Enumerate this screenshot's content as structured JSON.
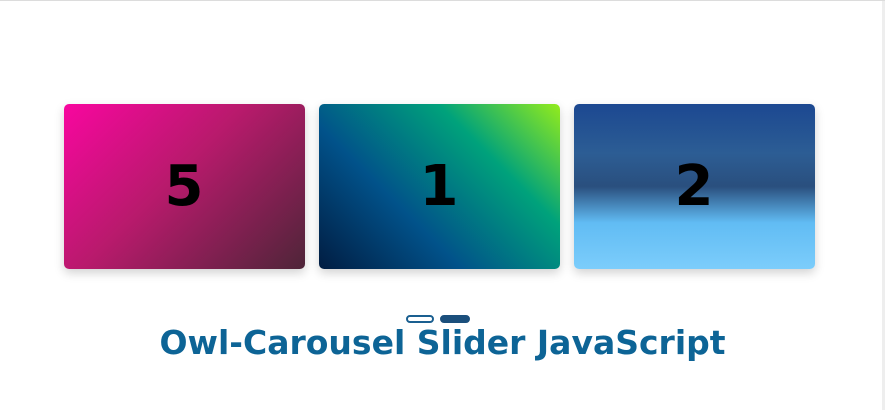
{
  "carousel": {
    "slides": [
      {
        "number": "5"
      },
      {
        "number": "1"
      },
      {
        "number": "2"
      }
    ],
    "dots": {
      "count": 2,
      "active_index": 1
    }
  },
  "page": {
    "title": "Owl-Carousel Slider JavaScript"
  },
  "colors": {
    "title": "#0d6496",
    "dot_active": "#1b4f7c",
    "dot_border": "#1a5f90"
  }
}
